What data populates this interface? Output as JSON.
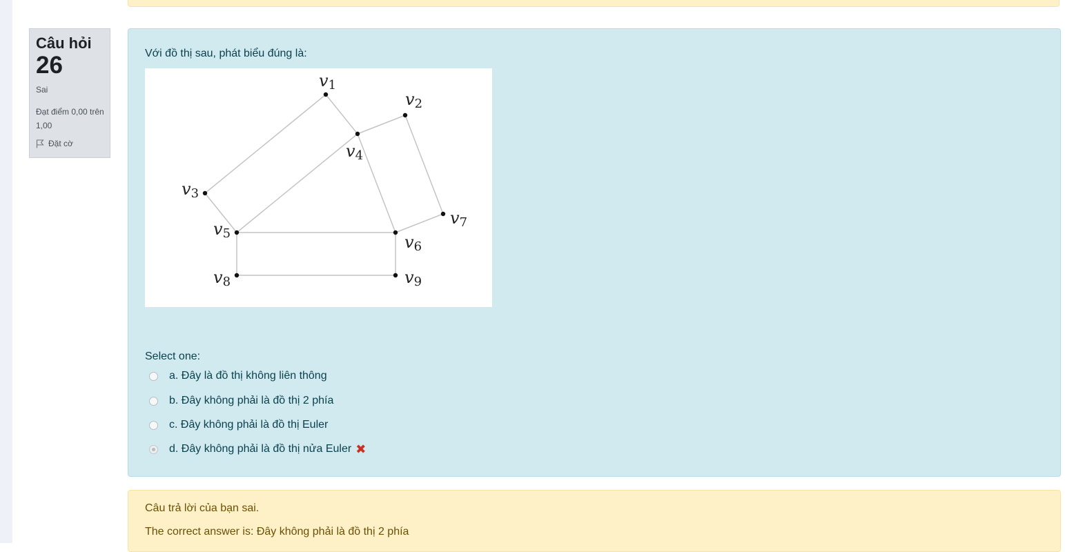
{
  "question_info": {
    "label": "Câu hỏi",
    "number": "26",
    "state": "Sai",
    "grade": "Đạt điểm 0,00 trên 1,00",
    "flag_label": "Đặt cờ"
  },
  "question": {
    "text": "Với đồ thị sau, phát biểu đúng là:",
    "prompt": "Select one:",
    "options": [
      {
        "label": "a. Đây là đồ thị không liên thông",
        "selected": false
      },
      {
        "label": "b. Đây không phải là đồ thị 2 phía",
        "selected": false
      },
      {
        "label": "c. Đây không phải là đồ thị Euler",
        "selected": false
      },
      {
        "label": "d. Đây không phải là đồ thị nửa Euler",
        "selected": true,
        "mark": "✖"
      }
    ]
  },
  "graph": {
    "vertices": [
      "v1",
      "v2",
      "v3",
      "v4",
      "v5",
      "v6",
      "v7",
      "v8",
      "v9"
    ],
    "edges": [
      [
        "v1",
        "v3"
      ],
      [
        "v1",
        "v4"
      ],
      [
        "v4",
        "v2"
      ],
      [
        "v2",
        "v7"
      ],
      [
        "v4",
        "v5"
      ],
      [
        "v4",
        "v6"
      ],
      [
        "v3",
        "v5"
      ],
      [
        "v5",
        "v6"
      ],
      [
        "v6",
        "v7"
      ],
      [
        "v5",
        "v8"
      ],
      [
        "v6",
        "v9"
      ],
      [
        "v8",
        "v9"
      ]
    ]
  },
  "feedback": {
    "result": "Câu trả lời của bạn sai.",
    "correct_answer": "The correct answer is: Đây không phải là đồ thị 2 phía"
  },
  "colors": {
    "question_bg": "#d0eaf0",
    "feedback_bg": "#fef1c8",
    "info_bg": "#dee2e6",
    "wrong": "#ca3120"
  }
}
